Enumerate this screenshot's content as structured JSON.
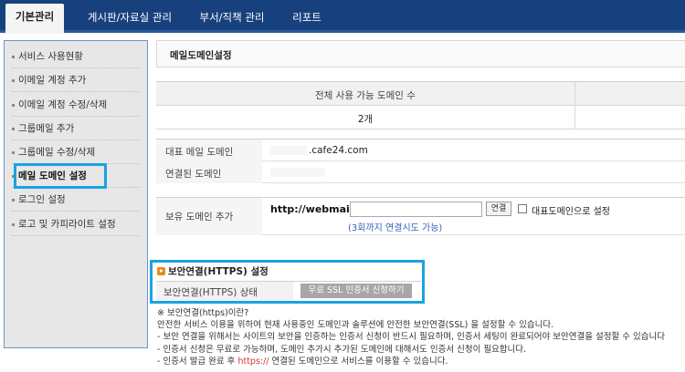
{
  "topnav": {
    "tabs": [
      {
        "label": "기본관리",
        "active": true
      },
      {
        "label": "게시판/자료실 관리",
        "active": false
      },
      {
        "label": "부서/직책 관리",
        "active": false
      },
      {
        "label": "리포트",
        "active": false
      }
    ]
  },
  "sidebar": {
    "items": [
      {
        "label": "서비스 사용현황"
      },
      {
        "label": "이메일 계정 추가"
      },
      {
        "label": "이메일 계정 수정/삭제"
      },
      {
        "label": "그룹메일 추가"
      },
      {
        "label": "그룹메일 수정/삭제"
      },
      {
        "label": "메일 도메인 설정",
        "selected": true
      },
      {
        "label": "로그인 설정"
      },
      {
        "label": "로고 및 카피라이트 설정"
      }
    ]
  },
  "main": {
    "title": "메일도메인설정",
    "available": {
      "header": "전체 사용 가능 도메인 수",
      "value": "2개"
    },
    "representative": {
      "label": "대표 메일 도메인",
      "value": ".cafe24.com"
    },
    "linked": {
      "label": "연결된 도메인",
      "value": ""
    },
    "add_domain": {
      "label": "보유 도메인 추가",
      "prefix": "http://webmail.",
      "input_value": "",
      "connect_button": "연결",
      "checkbox_label": "대표도메인으로 설정",
      "hint": "(3회까지 연결시도 가능)"
    },
    "security": {
      "title": "보안연결(HTTPS) 설정",
      "status_label": "보안연결(HTTPS) 상태",
      "button": "무료 SSL 인증서 신청하기"
    },
    "notes": {
      "heading": "※ 보안연결(https)이란?",
      "line1": "안전한 서비스 이용을 위하여 현재 사용중인 도메인과 솔루션에 안전한 보안연결(SSL) 을 설정할 수 있습니다.",
      "line2": "- 보안 연결을 위해서는 사이트의 보안을 인증하는 인증서 신청이 반드시 필요하며, 인증서 세팅이 완료되어야 보안연결을 설정할 수 있습니다",
      "line3": "- 인증서 신청은 무료로 가능하며, 도메인 추가시 추가된 도메인에 대해서도 인증서 신청이 필요합니다.",
      "line4_pre": "- 인증서 발급 완료 후 ",
      "line4_link": "https://",
      "line4_post": " 연결된 도메인으로 서비스를 이용할 수 있습니다."
    }
  }
}
